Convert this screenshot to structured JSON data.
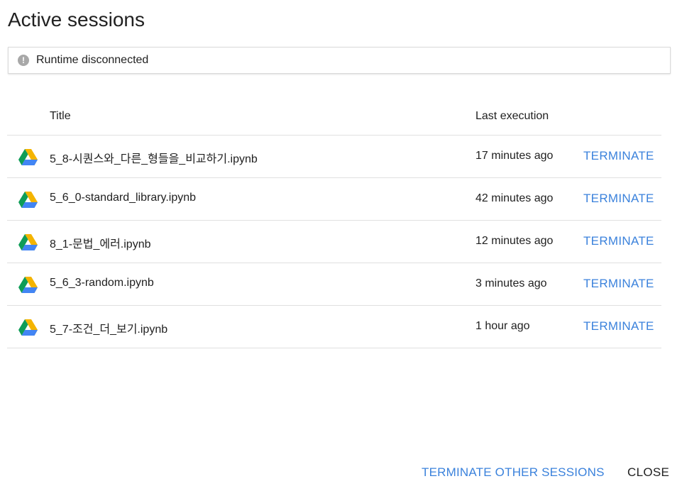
{
  "dialog": {
    "title": "Active sessions",
    "status": {
      "icon": "warning-icon",
      "icon_glyph": "!",
      "text": "Runtime disconnected"
    },
    "table": {
      "headers": {
        "title": "Title",
        "last_execution": "Last execution"
      },
      "rows": [
        {
          "icon": "google-drive-icon",
          "title": "5_8-시퀀스와_다른_형들을_비교하기.ipynb",
          "last_execution": "17 minutes ago",
          "action": "TERMINATE"
        },
        {
          "icon": "google-drive-icon",
          "title": "5_6_0-standard_library.ipynb",
          "last_execution": "42 minutes ago",
          "action": "TERMINATE"
        },
        {
          "icon": "google-drive-icon",
          "title": "8_1-문법_에러.ipynb",
          "last_execution": "12 minutes ago",
          "action": "TERMINATE"
        },
        {
          "icon": "google-drive-icon",
          "title": "5_6_3-random.ipynb",
          "last_execution": "3 minutes ago",
          "action": "TERMINATE"
        },
        {
          "icon": "google-drive-icon",
          "title": "5_7-조건_더_보기.ipynb",
          "last_execution": "1 hour ago",
          "action": "TERMINATE"
        }
      ]
    },
    "footer": {
      "terminate_other_label": "TERMINATE OTHER SESSIONS",
      "close_label": "CLOSE"
    },
    "colors": {
      "accent": "#3b82dc",
      "text": "#212121",
      "divider": "#e0e0e0",
      "drive_green": "#0f9d58",
      "drive_yellow": "#f4b400",
      "drive_blue": "#4285f4"
    }
  }
}
